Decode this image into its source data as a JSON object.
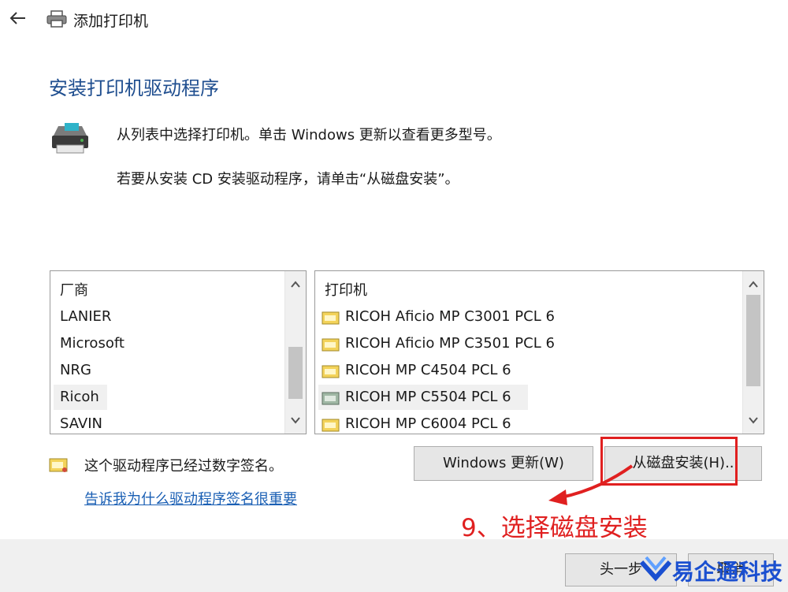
{
  "window": {
    "title": "添加打印机"
  },
  "heading": "安装打印机驱动程序",
  "description": {
    "line1": "从列表中选择打印机。单击 Windows 更新以查看更多型号。",
    "line2": "若要从安装 CD 安装驱动程序，请单击“从磁盘安装”。"
  },
  "manufacturer_list": {
    "header": "厂商",
    "items": [
      "LANIER",
      "Microsoft",
      "NRG",
      "Ricoh",
      "SAVIN"
    ],
    "selected": "Ricoh"
  },
  "printer_list": {
    "header": "打印机",
    "items": [
      "RICOH Aficio MP C3001 PCL 6",
      "RICOH Aficio MP C3501 PCL 6",
      "RICOH MP C4504 PCL 6",
      "RICOH MP C5504 PCL 6",
      "RICOH MP C6004 PCL 6"
    ],
    "selected": "RICOH MP C5504 PCL 6"
  },
  "signature": {
    "text": "这个驱动程序已经过数字签名。",
    "link": "告诉我为什么驱动程序签名很重要"
  },
  "buttons": {
    "windows_update": "Windows 更新(W)",
    "have_disk": "从磁盘安装(H)..",
    "next": "头一步",
    "cancel": "取消"
  },
  "annotation": {
    "text": "9、选择磁盘安装",
    "color": "#e02020"
  },
  "watermark": {
    "text": "易企通科技"
  },
  "colors": {
    "heading": "#1f4e8f",
    "link": "#1a5fb4",
    "annotation": "#e02020",
    "watermark": "#1a4fd0"
  },
  "icons": [
    "back-arrow-icon",
    "printer-icon",
    "printer-large-icon",
    "certificate-icon",
    "chevron-up-icon",
    "chevron-down-icon"
  ]
}
